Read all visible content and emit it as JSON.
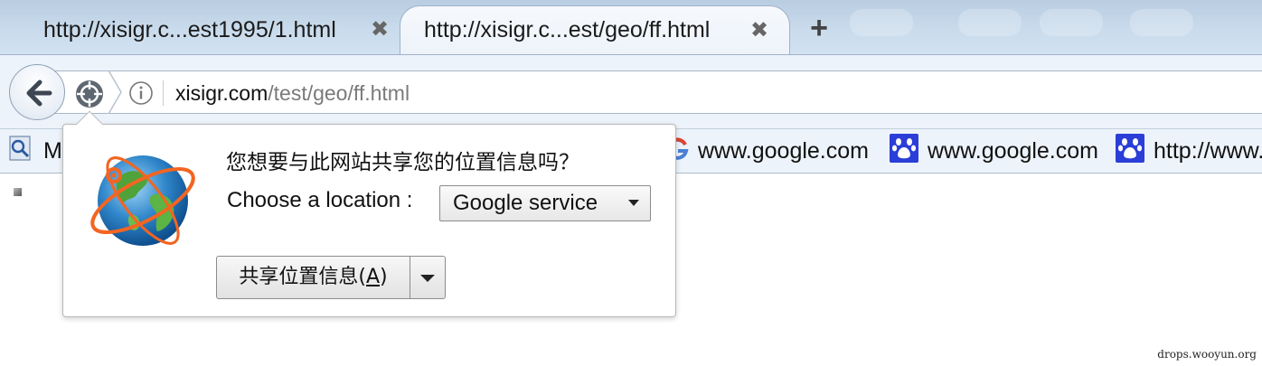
{
  "tabs": [
    {
      "title": "http://xisigr.c...est1995/1.html",
      "active": false
    },
    {
      "title": "http://xisigr.c...est/geo/ff.html",
      "active": true
    }
  ],
  "tab_close_glyph": "✖",
  "new_tab_glyph": "+",
  "url": {
    "host": "xisigr.com",
    "path": "/test/geo/ff.html"
  },
  "bookmarks": [
    {
      "label": "M",
      "icon": "search-page-icon"
    },
    {
      "label": "www.google.com",
      "icon": "google-g-icon"
    },
    {
      "label": "www.google.com",
      "icon": "baidu-paw-icon"
    },
    {
      "label": "http://www.",
      "icon": "baidu-paw-icon"
    }
  ],
  "geo_popup": {
    "message": "您想要与此网站共享您的位置信息吗？",
    "location_label": "Choose a location :",
    "location_selected": "Google service",
    "share_button_label": "共享位置信息(",
    "share_button_accesskey": "A",
    "share_button_label_end": ")"
  },
  "watermark": "drops.wooyun.org",
  "colors": {
    "tabstrip": "#c9dbec",
    "navbar": "#edf3fa",
    "baidu_blue": "#2b3ed8",
    "globe_orange": "#f26522"
  }
}
